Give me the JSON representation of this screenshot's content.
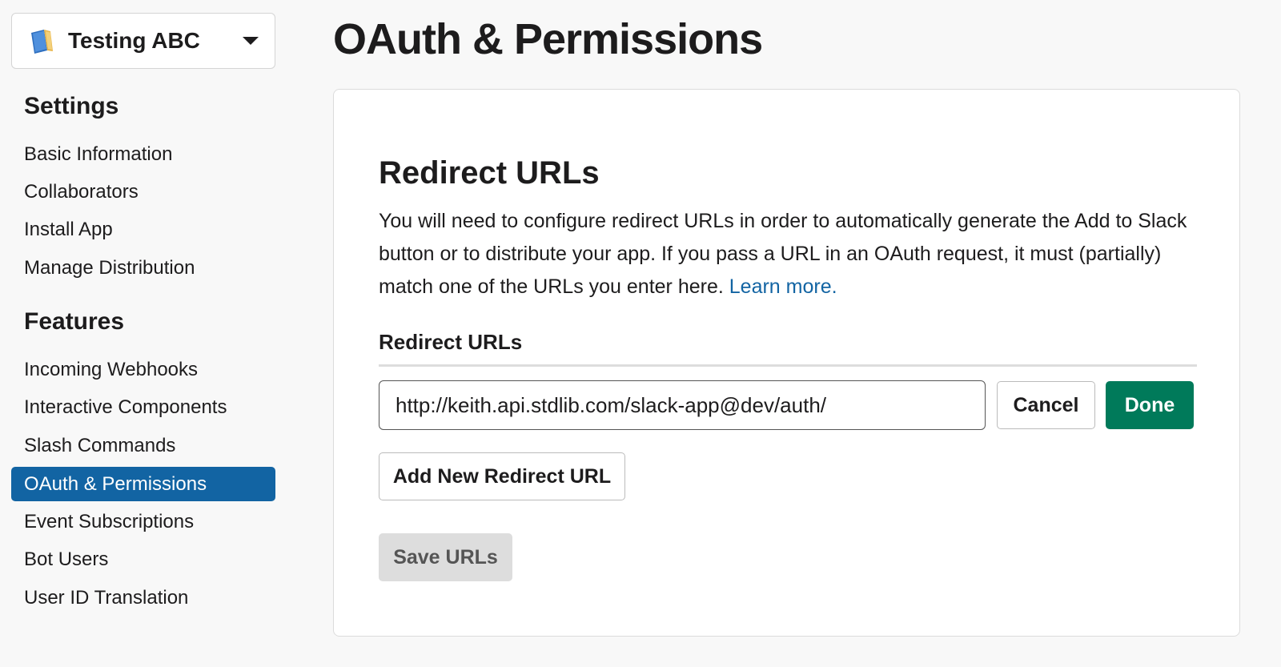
{
  "app_switcher": {
    "name": "Testing ABC",
    "icon": "book-icon"
  },
  "sidebar": {
    "settings_title": "Settings",
    "settings_items": [
      {
        "label": "Basic Information"
      },
      {
        "label": "Collaborators"
      },
      {
        "label": "Install App"
      },
      {
        "label": "Manage Distribution"
      }
    ],
    "features_title": "Features",
    "features_items": [
      {
        "label": "Incoming Webhooks"
      },
      {
        "label": "Interactive Components"
      },
      {
        "label": "Slash Commands"
      },
      {
        "label": "OAuth & Permissions",
        "active": true
      },
      {
        "label": "Event Subscriptions"
      },
      {
        "label": "Bot Users"
      },
      {
        "label": "User ID Translation"
      }
    ]
  },
  "page": {
    "title": "OAuth & Permissions"
  },
  "redirect": {
    "heading": "Redirect URLs",
    "description": "You will need to configure redirect URLs in order to automatically generate the Add to Slack button or to distribute your app. If you pass a URL in an OAuth request, it must (partially) match one of the URLs you enter here.",
    "learn_more": "Learn more.",
    "field_label": "Redirect URLs",
    "url_value": "http://keith.api.stdlib.com/slack-app@dev/auth/",
    "cancel_label": "Cancel",
    "done_label": "Done",
    "add_label": "Add New Redirect URL",
    "save_label": "Save URLs"
  },
  "colors": {
    "active_nav": "#1264a3",
    "done_button": "#007a5a",
    "link": "#1264a3",
    "save_button_disabled": "#dddddd"
  }
}
